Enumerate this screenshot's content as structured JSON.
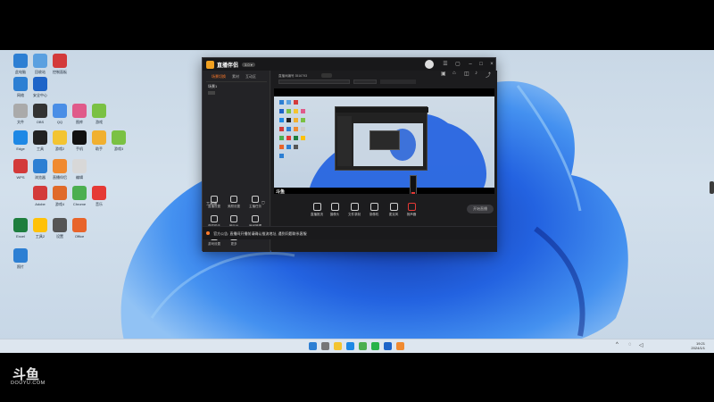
{
  "app": {
    "title": "直播伴侣",
    "version_badge": "3.0 ▾",
    "tabs": [
      "场景切换",
      "素材",
      "互动区"
    ],
    "tools_header": "工具箱",
    "tools": [
      {
        "label": "直播设置",
        "icon": "settings-icon"
      },
      {
        "label": "美颜设置",
        "icon": "beauty-icon"
      },
      {
        "label": "主播任务",
        "icon": "task-icon"
      },
      {
        "label": "弹幕助手",
        "icon": "danmaku-icon"
      },
      {
        "label": "音乐台",
        "icon": "music-icon"
      },
      {
        "label": "房间管理",
        "icon": "room-icon"
      },
      {
        "label": "游戏设置",
        "icon": "game-icon"
      },
      {
        "label": "更多",
        "icon": "more-icon"
      }
    ],
    "scene_item": "场景1",
    "top_info": "直播间编号 3516793",
    "controls": [
      {
        "label": "直播推流",
        "icon": "stream-icon"
      },
      {
        "label": "摄像头",
        "icon": "camera-icon"
      },
      {
        "label": "文件录制",
        "icon": "record-icon"
      },
      {
        "label": "录像机",
        "icon": "recorder-icon"
      },
      {
        "label": "麦克风",
        "icon": "mic-icon"
      },
      {
        "label": "扬声器",
        "icon": "speaker-icon"
      }
    ],
    "start_button": "开始直播",
    "notice": "官方公告: 直播间开播前请确认推流地址, 遇到问题联系客服"
  },
  "desktop_icons": [
    {
      "label": "此电脑",
      "color": "#2d7fd3"
    },
    {
      "label": "回收站",
      "color": "#5aa0e0"
    },
    {
      "label": "控制面板",
      "color": "#d33a3a"
    },
    {
      "label": "网络",
      "color": "#2d7fd3"
    },
    {
      "label": "安全中心",
      "color": "#1e64c8"
    },
    {
      "label": "文件",
      "color": "#aaaaaa"
    },
    {
      "label": "OBS",
      "color": "#333333"
    },
    {
      "label": "QQ",
      "color": "#4a8ee6"
    },
    {
      "label": "图库",
      "color": "#e05a8a"
    },
    {
      "label": "游戏",
      "color": "#7ac143"
    },
    {
      "label": "Edge",
      "color": "#1e88e5"
    },
    {
      "label": "工具",
      "color": "#222222"
    },
    {
      "label": "游戏2",
      "color": "#f3c431"
    },
    {
      "label": "手机",
      "color": "#111111"
    },
    {
      "label": "助手",
      "color": "#f0b030"
    },
    {
      "label": "游戏3",
      "color": "#7ac143"
    },
    {
      "label": "WPS",
      "color": "#d33a3a"
    },
    {
      "label": "浏览器",
      "color": "#2d7fd3"
    },
    {
      "label": "直播伴侣",
      "color": "#f08a30"
    },
    {
      "label": "编辑",
      "color": "#d8d8d8"
    },
    {
      "label": "Adobe",
      "color": "#d33a3a"
    },
    {
      "label": "游戏4",
      "color": "#e06a2a"
    },
    {
      "label": "Chrome",
      "color": "#4caf50"
    },
    {
      "label": "音乐",
      "color": "#e53935"
    },
    {
      "label": "Excel",
      "color": "#1e7e3e"
    },
    {
      "label": "工具2",
      "color": "#ffc107"
    },
    {
      "label": "设置",
      "color": "#555555"
    },
    {
      "label": "Office",
      "color": "#e8642a"
    },
    {
      "label": "照片",
      "color": "#2d7fd3"
    }
  ],
  "taskbar": {
    "time": "19:21",
    "date": "2024/1/1"
  },
  "watermark": {
    "logo": "斗鱼",
    "text": "DOUYU.COM"
  },
  "colors": {
    "accent": "#ff7a2a",
    "bloom": "#1e5fe0"
  }
}
